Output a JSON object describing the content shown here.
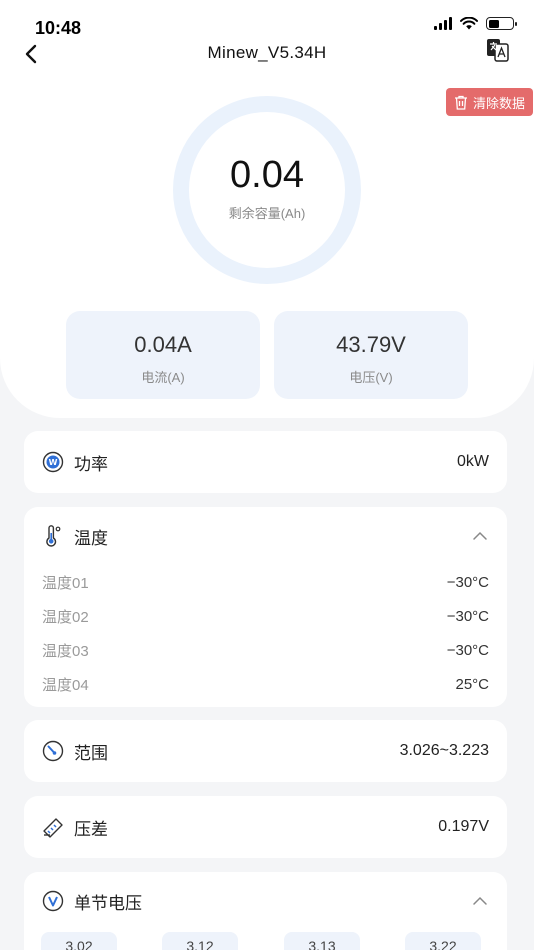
{
  "status_bar": {
    "time": "10:48"
  },
  "nav": {
    "title": "Minew_V5.34H"
  },
  "clear_button": {
    "label": "清除数据"
  },
  "capacity": {
    "value": "0.04",
    "label": "剩余容量(Ah)"
  },
  "current": {
    "value": "0.04A",
    "label": "电流(A)"
  },
  "voltage": {
    "value": "43.79V",
    "label": "电压(V)"
  },
  "power": {
    "title": "功率",
    "value": "0kW"
  },
  "temperature": {
    "title": "温度",
    "items": [
      {
        "label": "温度01",
        "value": "−30°C"
      },
      {
        "label": "温度02",
        "value": "−30°C"
      },
      {
        "label": "温度03",
        "value": "−30°C"
      },
      {
        "label": "温度04",
        "value": "25°C"
      }
    ]
  },
  "range": {
    "title": "范围",
    "value": "3.026~3.223"
  },
  "pressure_diff": {
    "title": "压差",
    "value": "0.197V"
  },
  "cell_voltage": {
    "title": "单节电压",
    "chips": [
      "3.02",
      "3.12",
      "3.13",
      "3.22"
    ]
  },
  "colors": {
    "accent": "#2f6fd6",
    "danger": "#e46b6b",
    "ring": "#eaf2fc"
  }
}
